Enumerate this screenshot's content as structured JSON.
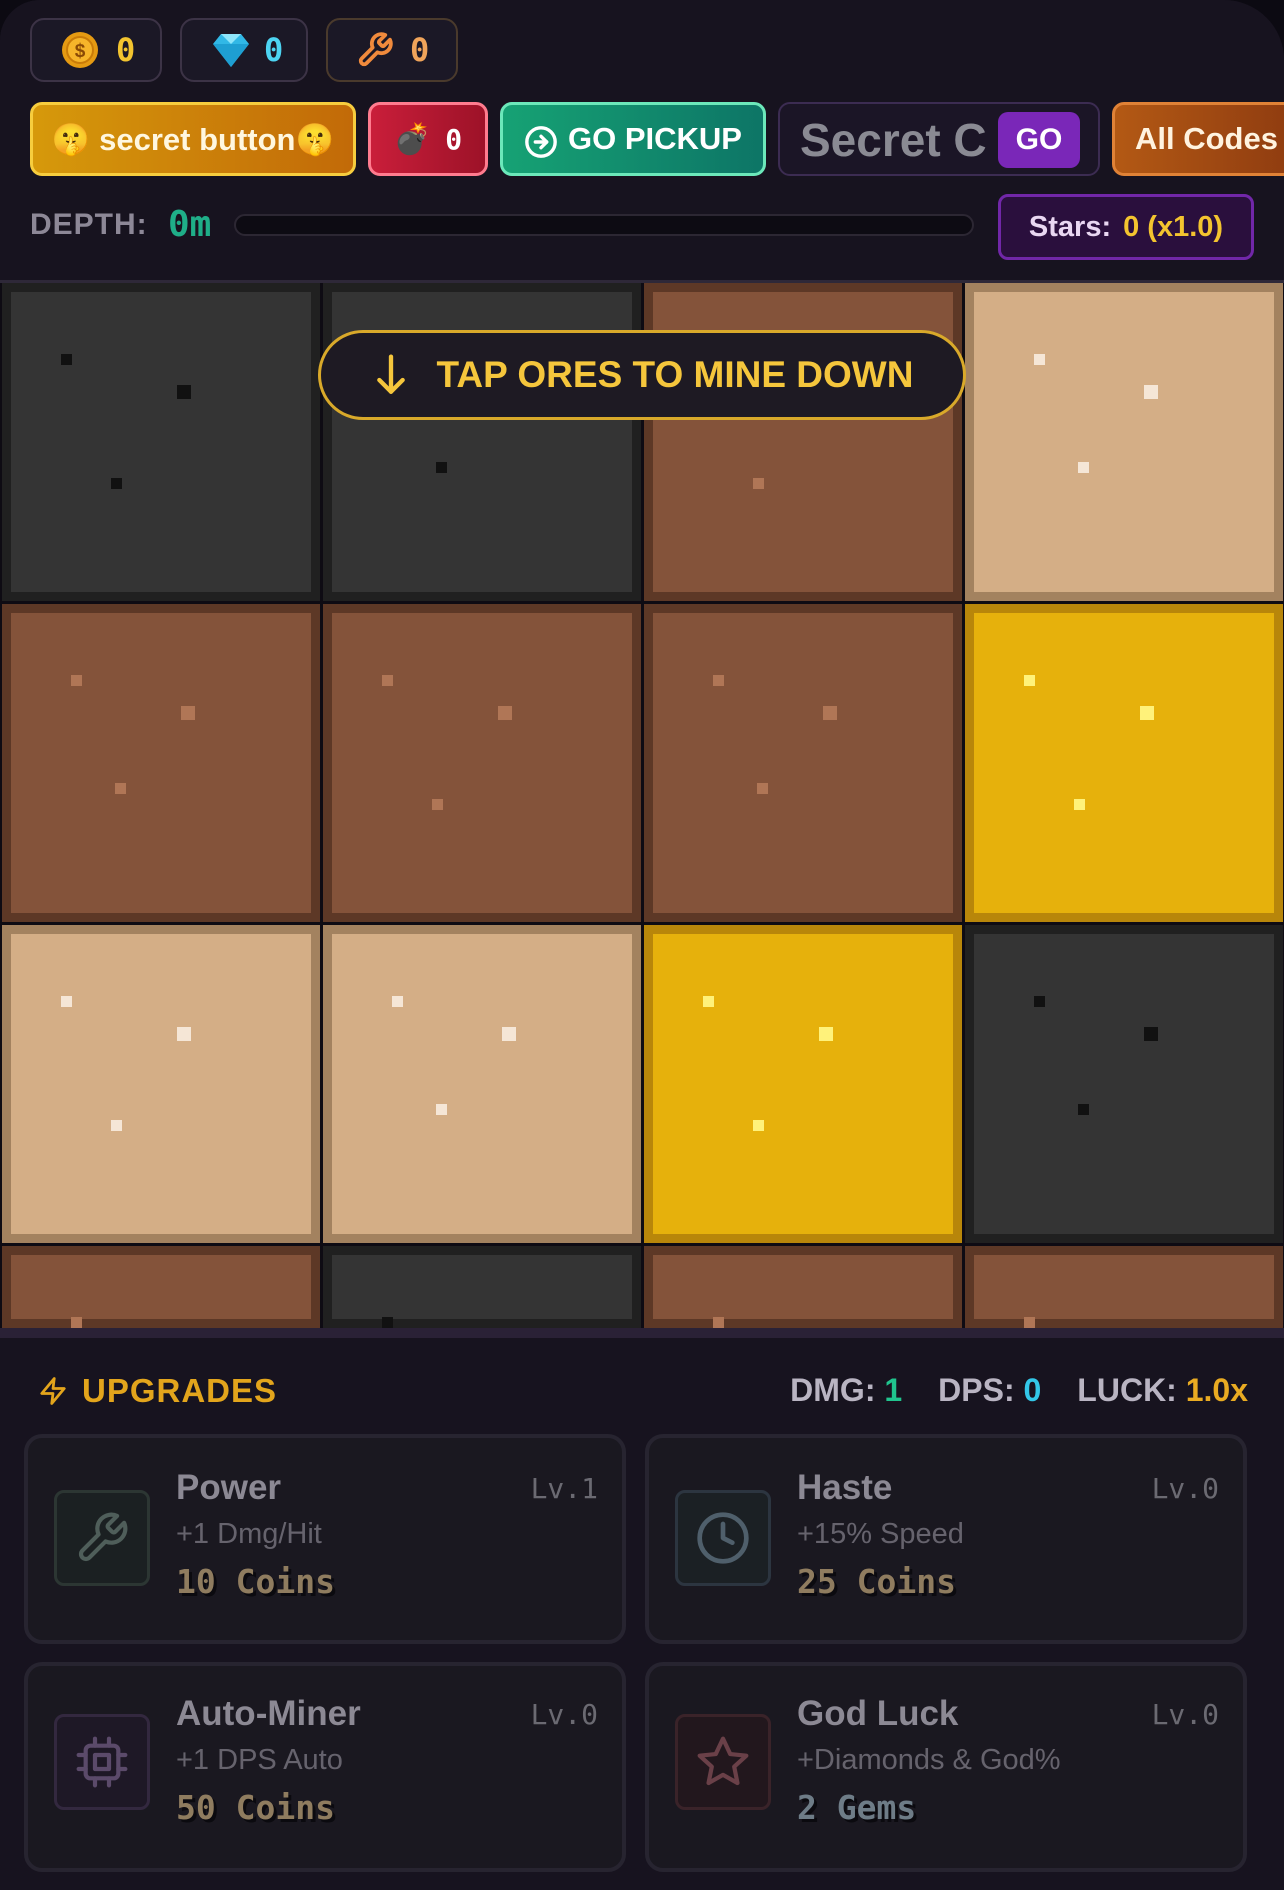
{
  "currencies": {
    "coins": "0",
    "gems": "0",
    "tools": "0"
  },
  "buttons": {
    "secret": "🤫 secret button🤫",
    "bomb_count": "0",
    "pickup": "GO PICKUP",
    "code_placeholder": "Secret C",
    "go": "GO",
    "all_codes": "All Codes"
  },
  "depth": {
    "label": "DEPTH:",
    "value": "0m",
    "progress": 0
  },
  "stars": {
    "label": "Stars:",
    "value": "0 (x1.0)"
  },
  "mine": {
    "hint": "TAP ORES TO MINE DOWN",
    "rows": [
      [
        "stone",
        "stone",
        "dirt",
        "sand"
      ],
      [
        "dirt",
        "dirt",
        "dirt",
        "gold"
      ],
      [
        "sand",
        "sand",
        "gold",
        "stone"
      ],
      [
        "dirt",
        "stone",
        "dirt",
        "dirt"
      ]
    ],
    "ore_colors": {
      "stone": "#343434",
      "dirt": "#84533a",
      "sand": "#d4ae86",
      "gold": "#e6b10c"
    }
  },
  "upgrades": {
    "title": "UPGRADES",
    "stats": {
      "dmg_label": "DMG:",
      "dmg_value": "1",
      "dps_label": "DPS:",
      "dps_value": "0",
      "luck_label": "LUCK:",
      "luck_value": "1.0x"
    },
    "items": [
      {
        "name": "Power",
        "desc": "+1 Dmg/Hit",
        "cost": "10 Coins",
        "level": "Lv.1",
        "icon": "wrench-icon"
      },
      {
        "name": "Haste",
        "desc": "+15% Speed",
        "cost": "25 Coins",
        "level": "Lv.0",
        "icon": "clock-icon"
      },
      {
        "name": "Auto-Miner",
        "desc": "+1 DPS Auto",
        "cost": "50 Coins",
        "level": "Lv.0",
        "icon": "cpu-chip-icon"
      },
      {
        "name": "God Luck",
        "desc": "+Diamonds & God%",
        "cost": "2 Gems",
        "level": "Lv.0",
        "icon": "star-icon"
      }
    ]
  },
  "colors": {
    "coin": "#f3c42f",
    "gem": "#4dd4f2",
    "tool": "#f08a3c",
    "dmg": "#20c48e",
    "dps": "#33c7e8",
    "luck": "#e9ab22"
  }
}
